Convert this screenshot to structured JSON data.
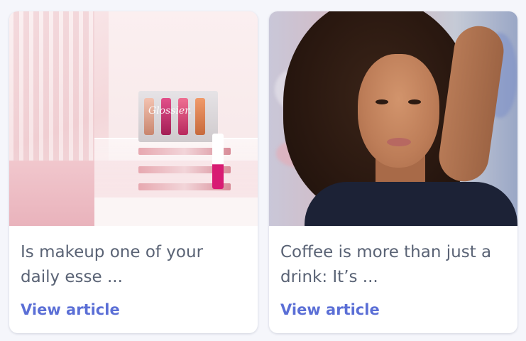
{
  "cards": [
    {
      "excerpt": "Is makeup one of your daily esse ...",
      "cta": "View article",
      "image": {
        "brand_text": "Glossier."
      }
    },
    {
      "excerpt": "Coffee is more than just a drink: It’s ...",
      "cta": "View article"
    }
  ],
  "colors": {
    "background": "#f5f6fb",
    "card": "#ffffff",
    "excerpt_text": "#5a6375",
    "link": "#5b6fd6"
  }
}
